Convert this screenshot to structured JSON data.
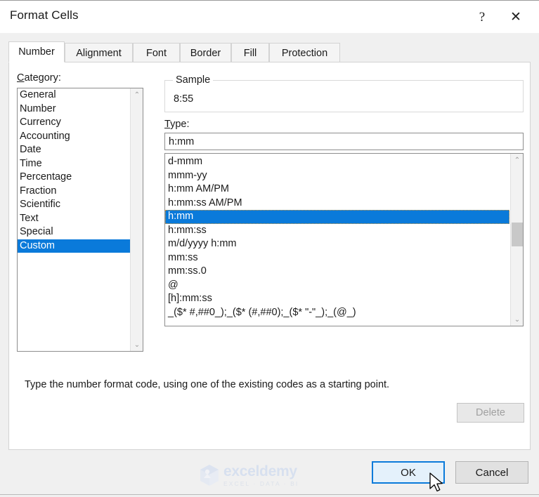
{
  "window": {
    "title": "Format Cells",
    "help_icon": "question-mark-icon",
    "close_icon": "close-icon",
    "help_label": "?",
    "close_label": "✕"
  },
  "tabs": [
    {
      "label": "Number",
      "active": true
    },
    {
      "label": "Alignment",
      "active": false
    },
    {
      "label": "Font",
      "active": false
    },
    {
      "label": "Border",
      "active": false
    },
    {
      "label": "Fill",
      "active": false
    },
    {
      "label": "Protection",
      "active": false
    }
  ],
  "category": {
    "label_prefix": "C",
    "label_rest": "ategory:",
    "items": [
      "General",
      "Number",
      "Currency",
      "Accounting",
      "Date",
      "Time",
      "Percentage",
      "Fraction",
      "Scientific",
      "Text",
      "Special",
      "Custom"
    ],
    "selected": "Custom",
    "selected_index": 11,
    "scroll_up_glyph": "⌃",
    "scroll_down_glyph": "⌄"
  },
  "sample": {
    "legend": "Sample",
    "value": "8:55"
  },
  "type": {
    "label_prefix": "T",
    "label_rest": "ype:",
    "input_value": "h:mm",
    "items": [
      "d-mmm",
      "mmm-yy",
      "h:mm AM/PM",
      "h:mm:ss AM/PM",
      "h:mm",
      "h:mm:ss",
      "m/d/yyyy h:mm",
      "mm:ss",
      "mm:ss.0",
      "@",
      "[h]:mm:ss",
      "_($* #,##0_);_($* (#,##0);_($* \"-\"_);_(@_)"
    ],
    "selected": "h:mm",
    "selected_index": 4,
    "scroll_up_glyph": "⌃",
    "scroll_down_glyph": "⌄"
  },
  "delete_button": {
    "label": "Delete",
    "disabled": true
  },
  "help_text": "Type the number format code, using one of the existing codes as a starting point.",
  "footer": {
    "ok_label": "OK",
    "cancel_label": "Cancel"
  },
  "watermark": {
    "name": "exceldemy",
    "tagline": "EXCEL · DATA · BI"
  },
  "colors": {
    "selection_blue": "#0a7ada",
    "default_button_border": "#0a7ada",
    "default_button_fill": "#e4f1fb",
    "dialog_bg": "#f0f0f0",
    "panel_bg": "#ffffff",
    "disabled_text": "#a0a0a0"
  }
}
